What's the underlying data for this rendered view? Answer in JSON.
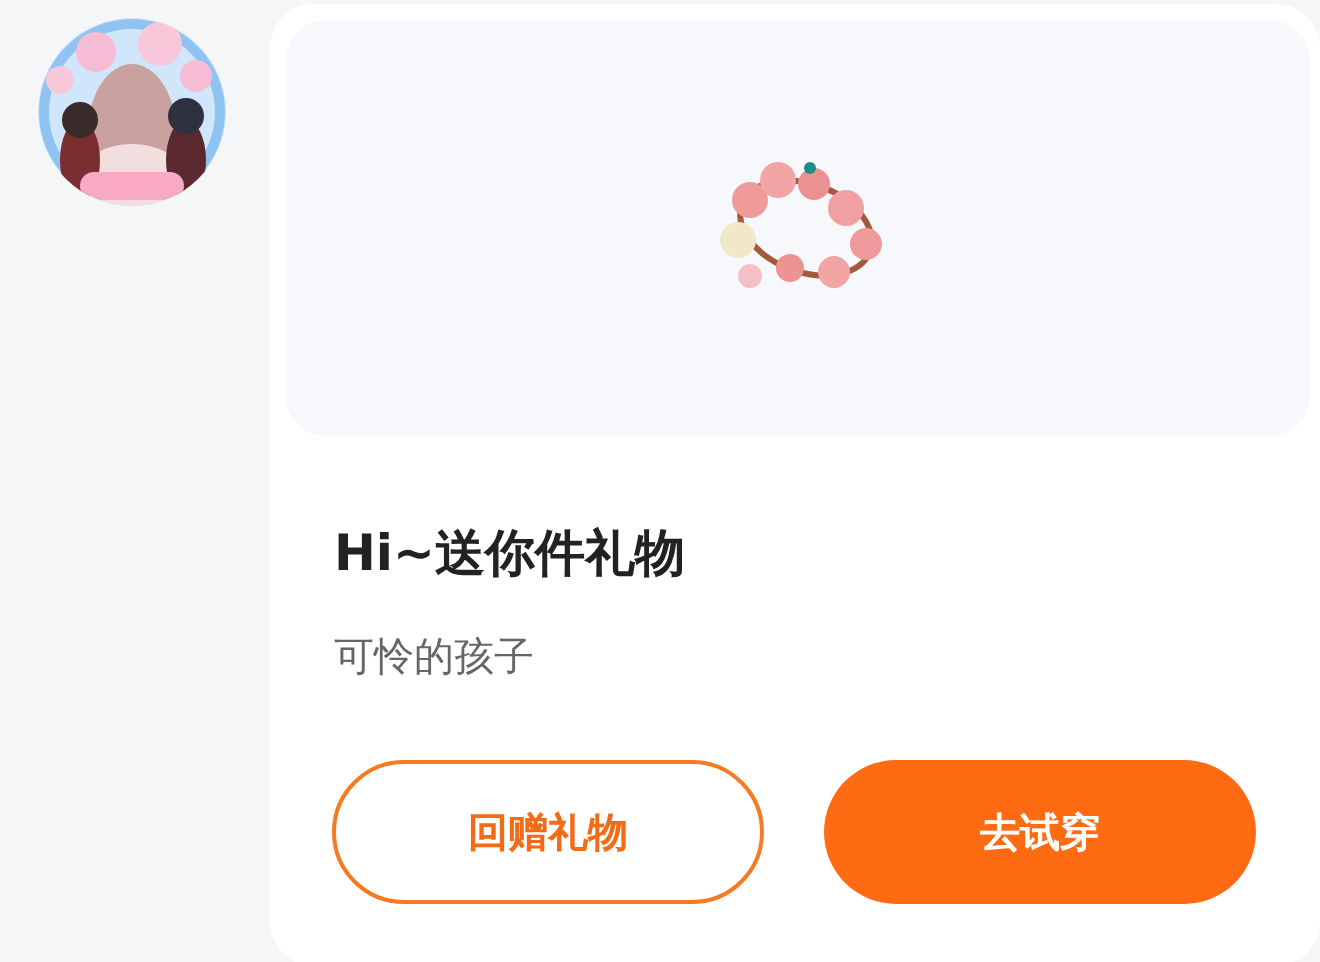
{
  "gift_card": {
    "title": "Hi~送你件礼物",
    "message": "可怜的孩子",
    "buttons": [
      {
        "label": "回赠礼物",
        "kind": "outline"
      },
      {
        "label": "去试穿",
        "kind": "filled"
      }
    ]
  }
}
